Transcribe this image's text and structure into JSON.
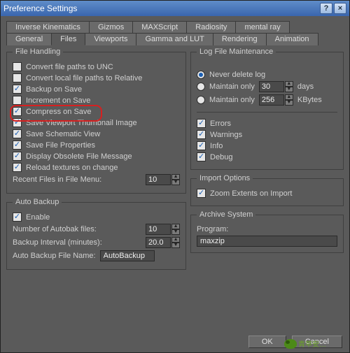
{
  "title": "Preference Settings",
  "tabs_row1": [
    "Inverse Kinematics",
    "Gizmos",
    "MAXScript",
    "Radiosity",
    "mental ray"
  ],
  "tabs_row2": [
    "General",
    "Files",
    "Viewports",
    "Gamma and LUT",
    "Rendering",
    "Animation"
  ],
  "active_tab": "Files",
  "file_handling": {
    "legend": "File Handling",
    "items": [
      {
        "label": "Convert file paths to UNC",
        "checked": false
      },
      {
        "label": "Convert local file paths to Relative",
        "checked": false
      },
      {
        "label": "Backup on Save",
        "checked": true
      },
      {
        "label": "Increment on Save",
        "checked": false
      },
      {
        "label": "Compress on Save",
        "checked": true,
        "highlight": true
      },
      {
        "label": "Save Viewport Thumbnail Image",
        "checked": true
      },
      {
        "label": "Save Schematic View",
        "checked": true
      },
      {
        "label": "Save File Properties",
        "checked": true
      },
      {
        "label": "Display Obsolete File Message",
        "checked": true
      },
      {
        "label": "Reload textures on change",
        "checked": true
      }
    ],
    "recent_label": "Recent Files in File Menu:",
    "recent_value": "10"
  },
  "auto_backup": {
    "legend": "Auto Backup",
    "enable_label": "Enable",
    "enable_checked": true,
    "num_label": "Number of Autobak files:",
    "num_value": "10",
    "interval_label": "Backup Interval (minutes):",
    "interval_value": "20.0",
    "name_label": "Auto Backup File Name:",
    "name_value": "AutoBackup"
  },
  "log_maint": {
    "legend": "Log File Maintenance",
    "never_label": "Never delete log",
    "never_selected": true,
    "days_label": "Maintain only",
    "days_value": "30",
    "days_unit": "days",
    "days_selected": false,
    "kb_label": "Maintain only",
    "kb_value": "256",
    "kb_unit": "KBytes",
    "kb_selected": false,
    "flags": [
      {
        "label": "Errors",
        "checked": true
      },
      {
        "label": "Warnings",
        "checked": true
      },
      {
        "label": "Info",
        "checked": true
      },
      {
        "label": "Debug",
        "checked": true
      }
    ]
  },
  "import_options": {
    "legend": "Import Options",
    "zoom_label": "Zoom Extents on Import",
    "zoom_checked": true
  },
  "archive_system": {
    "legend": "Archive System",
    "program_label": "Program:",
    "program_value": "maxzip"
  },
  "buttons": {
    "ok": "OK",
    "cancel": "Cancel"
  },
  "watermark": "青苹安…"
}
